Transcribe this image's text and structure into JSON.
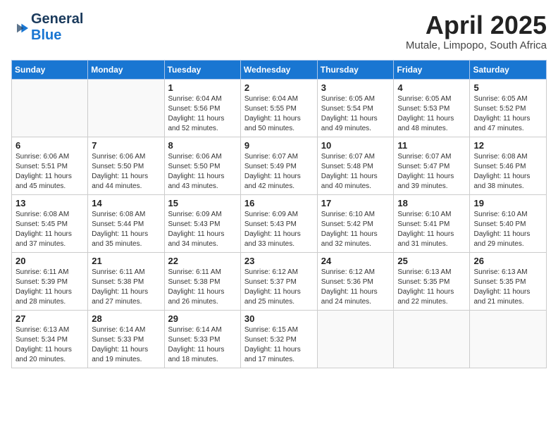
{
  "header": {
    "logo_line1": "General",
    "logo_line2": "Blue",
    "title": "April 2025",
    "subtitle": "Mutale, Limpopo, South Africa"
  },
  "days_of_week": [
    "Sunday",
    "Monday",
    "Tuesday",
    "Wednesday",
    "Thursday",
    "Friday",
    "Saturday"
  ],
  "weeks": [
    [
      {
        "num": "",
        "info": ""
      },
      {
        "num": "",
        "info": ""
      },
      {
        "num": "1",
        "info": "Sunrise: 6:04 AM\nSunset: 5:56 PM\nDaylight: 11 hours and 52 minutes."
      },
      {
        "num": "2",
        "info": "Sunrise: 6:04 AM\nSunset: 5:55 PM\nDaylight: 11 hours and 50 minutes."
      },
      {
        "num": "3",
        "info": "Sunrise: 6:05 AM\nSunset: 5:54 PM\nDaylight: 11 hours and 49 minutes."
      },
      {
        "num": "4",
        "info": "Sunrise: 6:05 AM\nSunset: 5:53 PM\nDaylight: 11 hours and 48 minutes."
      },
      {
        "num": "5",
        "info": "Sunrise: 6:05 AM\nSunset: 5:52 PM\nDaylight: 11 hours and 47 minutes."
      }
    ],
    [
      {
        "num": "6",
        "info": "Sunrise: 6:06 AM\nSunset: 5:51 PM\nDaylight: 11 hours and 45 minutes."
      },
      {
        "num": "7",
        "info": "Sunrise: 6:06 AM\nSunset: 5:50 PM\nDaylight: 11 hours and 44 minutes."
      },
      {
        "num": "8",
        "info": "Sunrise: 6:06 AM\nSunset: 5:50 PM\nDaylight: 11 hours and 43 minutes."
      },
      {
        "num": "9",
        "info": "Sunrise: 6:07 AM\nSunset: 5:49 PM\nDaylight: 11 hours and 42 minutes."
      },
      {
        "num": "10",
        "info": "Sunrise: 6:07 AM\nSunset: 5:48 PM\nDaylight: 11 hours and 40 minutes."
      },
      {
        "num": "11",
        "info": "Sunrise: 6:07 AM\nSunset: 5:47 PM\nDaylight: 11 hours and 39 minutes."
      },
      {
        "num": "12",
        "info": "Sunrise: 6:08 AM\nSunset: 5:46 PM\nDaylight: 11 hours and 38 minutes."
      }
    ],
    [
      {
        "num": "13",
        "info": "Sunrise: 6:08 AM\nSunset: 5:45 PM\nDaylight: 11 hours and 37 minutes."
      },
      {
        "num": "14",
        "info": "Sunrise: 6:08 AM\nSunset: 5:44 PM\nDaylight: 11 hours and 35 minutes."
      },
      {
        "num": "15",
        "info": "Sunrise: 6:09 AM\nSunset: 5:43 PM\nDaylight: 11 hours and 34 minutes."
      },
      {
        "num": "16",
        "info": "Sunrise: 6:09 AM\nSunset: 5:43 PM\nDaylight: 11 hours and 33 minutes."
      },
      {
        "num": "17",
        "info": "Sunrise: 6:10 AM\nSunset: 5:42 PM\nDaylight: 11 hours and 32 minutes."
      },
      {
        "num": "18",
        "info": "Sunrise: 6:10 AM\nSunset: 5:41 PM\nDaylight: 11 hours and 31 minutes."
      },
      {
        "num": "19",
        "info": "Sunrise: 6:10 AM\nSunset: 5:40 PM\nDaylight: 11 hours and 29 minutes."
      }
    ],
    [
      {
        "num": "20",
        "info": "Sunrise: 6:11 AM\nSunset: 5:39 PM\nDaylight: 11 hours and 28 minutes."
      },
      {
        "num": "21",
        "info": "Sunrise: 6:11 AM\nSunset: 5:38 PM\nDaylight: 11 hours and 27 minutes."
      },
      {
        "num": "22",
        "info": "Sunrise: 6:11 AM\nSunset: 5:38 PM\nDaylight: 11 hours and 26 minutes."
      },
      {
        "num": "23",
        "info": "Sunrise: 6:12 AM\nSunset: 5:37 PM\nDaylight: 11 hours and 25 minutes."
      },
      {
        "num": "24",
        "info": "Sunrise: 6:12 AM\nSunset: 5:36 PM\nDaylight: 11 hours and 24 minutes."
      },
      {
        "num": "25",
        "info": "Sunrise: 6:13 AM\nSunset: 5:35 PM\nDaylight: 11 hours and 22 minutes."
      },
      {
        "num": "26",
        "info": "Sunrise: 6:13 AM\nSunset: 5:35 PM\nDaylight: 11 hours and 21 minutes."
      }
    ],
    [
      {
        "num": "27",
        "info": "Sunrise: 6:13 AM\nSunset: 5:34 PM\nDaylight: 11 hours and 20 minutes."
      },
      {
        "num": "28",
        "info": "Sunrise: 6:14 AM\nSunset: 5:33 PM\nDaylight: 11 hours and 19 minutes."
      },
      {
        "num": "29",
        "info": "Sunrise: 6:14 AM\nSunset: 5:33 PM\nDaylight: 11 hours and 18 minutes."
      },
      {
        "num": "30",
        "info": "Sunrise: 6:15 AM\nSunset: 5:32 PM\nDaylight: 11 hours and 17 minutes."
      },
      {
        "num": "",
        "info": ""
      },
      {
        "num": "",
        "info": ""
      },
      {
        "num": "",
        "info": ""
      }
    ]
  ]
}
